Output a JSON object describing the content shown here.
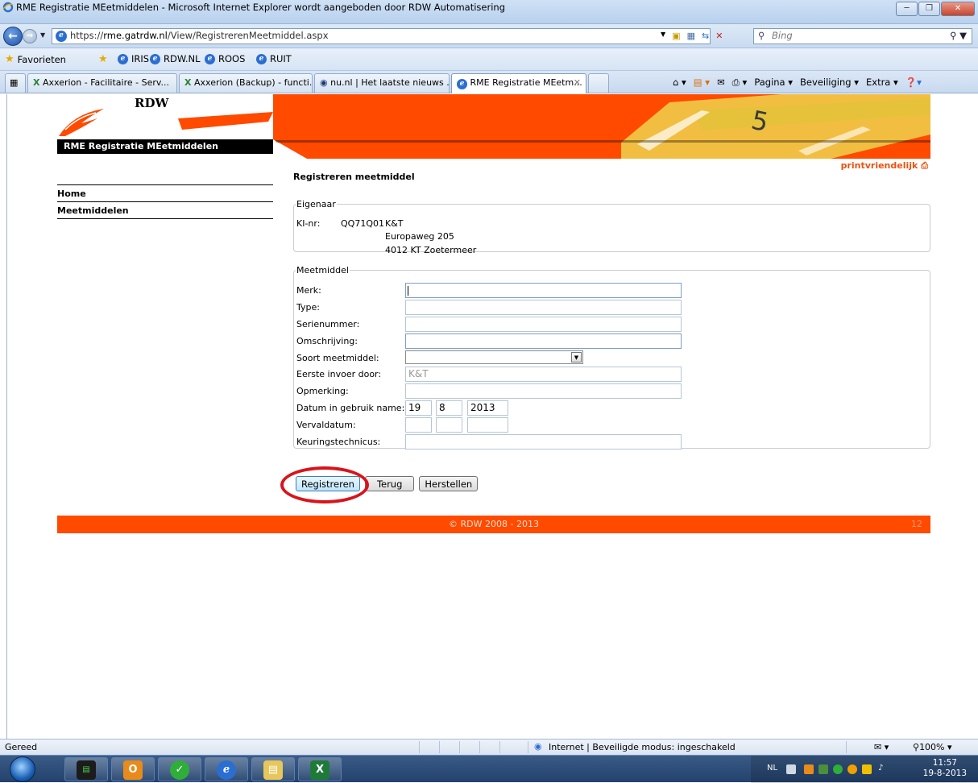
{
  "window": {
    "title": "RME Registratie MEetmiddelen - Microsoft Internet Explorer wordt aangeboden door RDW Automatisering"
  },
  "address": {
    "url_prefix": "https://",
    "url_host": "rme.gatrdw.nl",
    "url_path": "/View/RegistrerenMeetmiddel.aspx",
    "search_placeholder": "Bing"
  },
  "favorites": {
    "label": "Favorieten",
    "links": [
      "IRIS",
      "RDW.NL",
      "ROOS",
      "RUIT"
    ]
  },
  "tabs": [
    {
      "label": "Axxerion - Facilitaire - Serv..."
    },
    {
      "label": "Axxerion (Backup) - functi..."
    },
    {
      "label": "nu.nl | Het laatste nieuws ..."
    },
    {
      "label": "RME Registratie MEetm..."
    }
  ],
  "commandbar": {
    "pagina": "Pagina",
    "beveiliging": "Beveiliging",
    "extra": "Extra"
  },
  "page": {
    "brand": "RDW",
    "app_name": "RME Registratie MEetmiddelen",
    "print_link": "printvriendelijk",
    "title": "Registreren meetmiddel",
    "nav": [
      "Home",
      "Meetmiddelen"
    ],
    "owner": {
      "legend": "Eigenaar",
      "ki_label": "KI-nr:",
      "ki_value": "QQ71Q01",
      "name": "K&T",
      "street": "Europaweg 205",
      "city": "4012 KT Zoetermeer"
    },
    "meetmiddel": {
      "legend": "Meetmiddel",
      "labels": {
        "merk": "Merk:",
        "type": "Type:",
        "serienummer": "Serienummer:",
        "omschrijving": "Omschrijving:",
        "soort": "Soort meetmiddel:",
        "eerste_invoer": "Eerste invoer door:",
        "opmerking": "Opmerking:",
        "datum": "Datum in gebruik name:",
        "vervaldatum": "Vervaldatum:",
        "keuringstechnicus": "Keuringstechnicus:"
      },
      "values": {
        "eerste_invoer": "K&T",
        "datum_dag": "19",
        "datum_maand": "8",
        "datum_jaar": "2013"
      }
    },
    "buttons": {
      "registreren": "Registreren",
      "terug": "Terug",
      "herstellen": "Herstellen"
    },
    "footer": {
      "copyright": "© RDW 2008 - 2013",
      "page_number": "12"
    }
  },
  "statusbar": {
    "status": "Gereed",
    "zone": "Internet | Beveiligde modus: ingeschakeld",
    "zoom": "100%"
  },
  "taskbar": {
    "lang": "NL",
    "time": "11:57",
    "date": "19-8-2013"
  },
  "colors": {
    "brand_orange": "#ff4a00",
    "highlight_red": "#d8141b"
  }
}
